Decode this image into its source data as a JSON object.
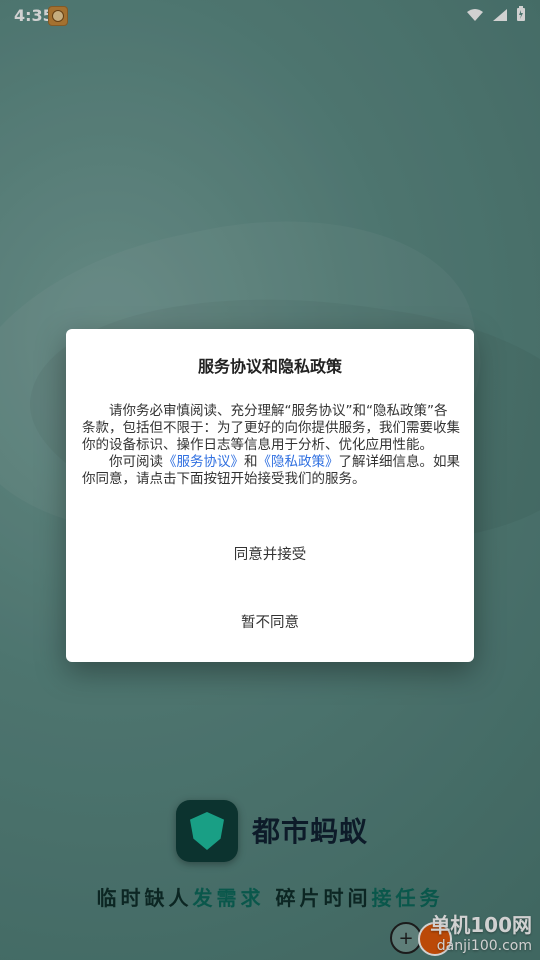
{
  "status_bar": {
    "time": "4:35"
  },
  "brand": {
    "name": "都市蚂蚁",
    "tagline_parts": [
      "临时缺人",
      "发需求",
      "碎片时间",
      "接任务"
    ]
  },
  "dialog": {
    "title": "服务协议和隐私政策",
    "para1": "请你务必审慎阅读、充分理解“服务协议”和“隐私政策”各条款，包括但不限于：为了更好的向你提供服务，我们需要收集你的设备标识、操作日志等信息用于分析、优化应用性能。",
    "para2_prefix": "你可阅读",
    "link_service": "《服务协议》",
    "and_text": "和",
    "link_privacy": "《隐私政策》",
    "para2_suffix": "了解详细信息。如果你同意，请点击下面按钮开始接受我们的服务。",
    "agree_button": "同意并接受",
    "decline_button": "暂不同意"
  },
  "watermark": {
    "title": "单机100网",
    "domain": "danji100.com"
  },
  "colors": {
    "accent_link": "#2f6fe0",
    "brand_green": "#1fc3a3"
  }
}
